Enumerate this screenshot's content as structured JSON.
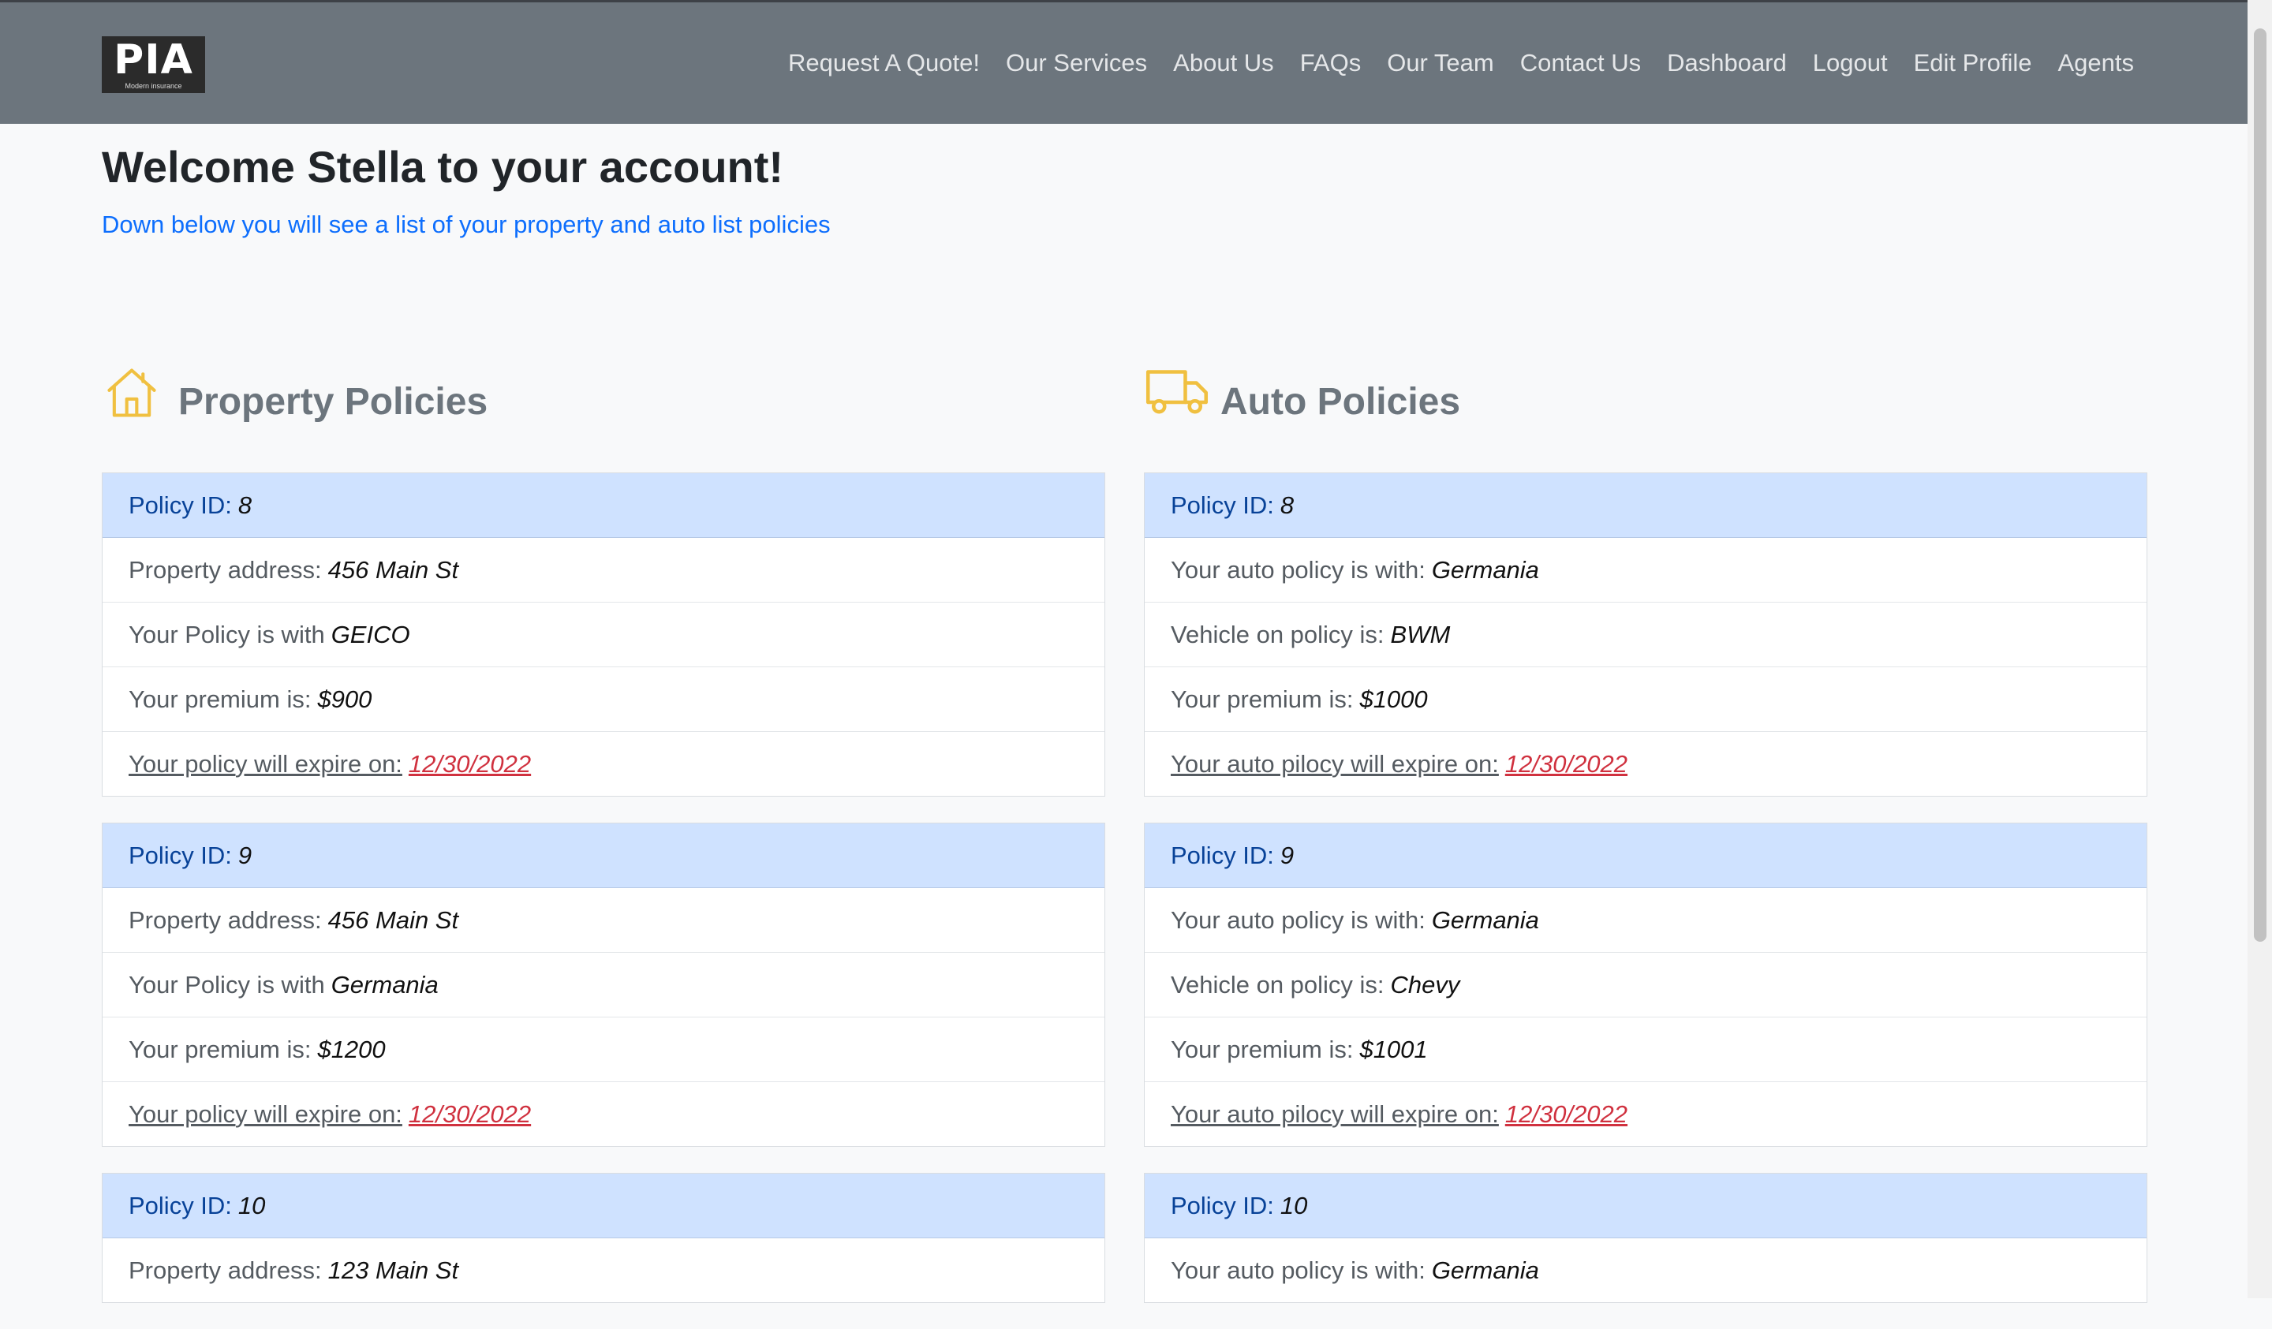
{
  "navbar": {
    "logo_text": "PIA",
    "logo_tagline": "Modern insurance",
    "links": [
      "Request A Quote!",
      "Our Services",
      "About Us",
      "FAQs",
      "Our Team",
      "Contact Us",
      "Dashboard",
      "Logout",
      "Edit Profile",
      "Agents"
    ]
  },
  "page": {
    "welcome": "Welcome Stella to your account!",
    "subtitle": "Down below you will see a list of your property and auto list policies"
  },
  "colors": {
    "navbar": "#6c757d",
    "card_header": "#cfe2ff",
    "link_blue": "#0d6efd",
    "expire_red": "#d0313f",
    "icon_yellow": "#f0c040"
  },
  "property": {
    "title": "Property Policies",
    "icon": "house-icon",
    "labels": {
      "id": "Policy ID:",
      "address": "Property address:",
      "company": "Your Policy is with",
      "premium": "Your premium is:",
      "expire": "Your policy will expire on:"
    },
    "policies": [
      {
        "id": "8",
        "address": "456 Main St",
        "company": "GEICO",
        "premium": "$900",
        "expire": "12/30/2022"
      },
      {
        "id": "9",
        "address": "456 Main St",
        "company": "Germania",
        "premium": "$1200",
        "expire": "12/30/2022"
      },
      {
        "id": "10",
        "address": "123 Main St"
      }
    ]
  },
  "auto": {
    "title": "Auto Policies",
    "icon": "truck-icon",
    "labels": {
      "id": "Policy ID:",
      "company": "Your auto policy is with:",
      "vehicle": "Vehicle on policy is:",
      "premium": "Your premium is:",
      "expire": "Your auto pilocy will expire on:"
    },
    "policies": [
      {
        "id": "8",
        "company": "Germania",
        "vehicle": "BWM",
        "premium": "$1000",
        "expire": "12/30/2022"
      },
      {
        "id": "9",
        "company": "Germania",
        "vehicle": "Chevy",
        "premium": "$1001",
        "expire": "12/30/2022"
      },
      {
        "id": "10",
        "company": "Germania"
      }
    ]
  }
}
